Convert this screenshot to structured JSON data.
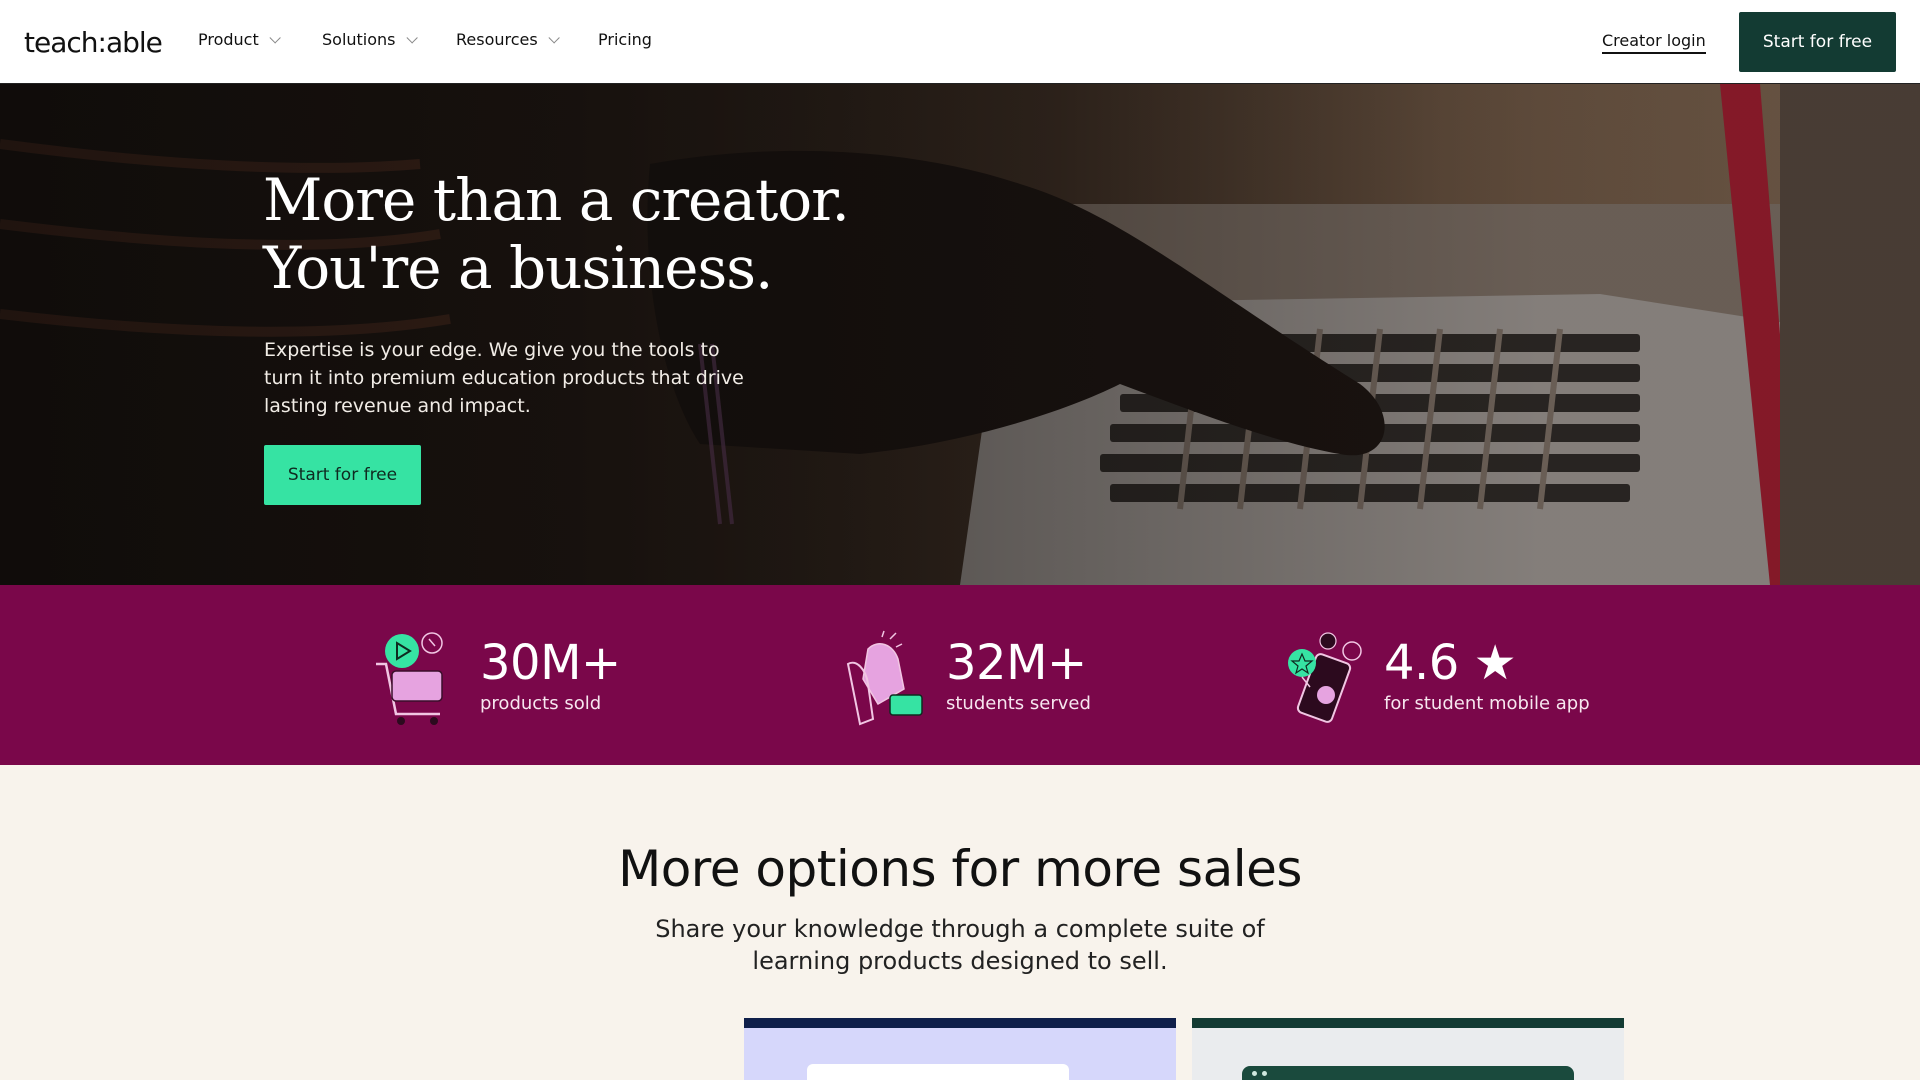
{
  "nav": {
    "logo": "teach:able",
    "items": [
      {
        "label": "Product",
        "has_dropdown": true
      },
      {
        "label": "Solutions",
        "has_dropdown": true
      },
      {
        "label": "Resources",
        "has_dropdown": true
      },
      {
        "label": "Pricing",
        "has_dropdown": false
      }
    ],
    "login_label": "Creator login",
    "cta_label": "Start for free"
  },
  "hero": {
    "title_line1": "More than a creator.",
    "title_line2": "You're a business.",
    "subtitle": "Expertise is your edge. We give you the tools to turn it into premium education products that drive lasting revenue and impact.",
    "cta_label": "Start for free"
  },
  "stats": [
    {
      "value": "30M+",
      "label": "products sold",
      "icon": "shopping-cart-icon"
    },
    {
      "value": "32M+",
      "label": "students served",
      "icon": "high-five-icon"
    },
    {
      "value": "4.6 ★",
      "label": "for student mobile app",
      "icon": "mobile-app-icon"
    }
  ],
  "options": {
    "title": "More options for more sales",
    "subtitle": "Share your knowledge through a complete suite of learning products designed to sell."
  },
  "colors": {
    "nav_cta_bg": "#133b33",
    "hero_cta_bg": "#36e3a3",
    "stats_bg": "#7a074a",
    "page_bg": "#f8f3ec"
  }
}
